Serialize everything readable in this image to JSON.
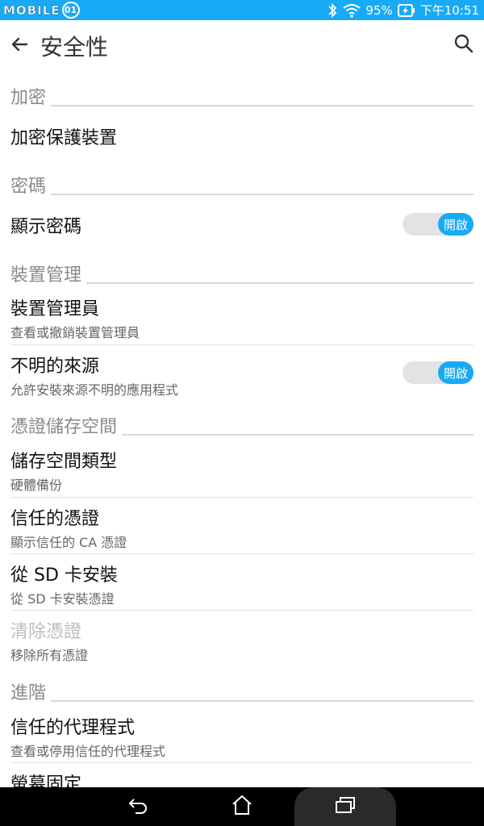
{
  "status_bar": {
    "logo_text": "MOBILE",
    "logo_face": "01",
    "battery": "95%",
    "time": "下午10:51",
    "icons": [
      "bluetooth-icon",
      "wifi-icon",
      "battery-charging-icon"
    ]
  },
  "app_bar": {
    "title": "安全性",
    "back_icon": "arrow-back-icon",
    "search_icon": "search-icon"
  },
  "sections": {
    "encryption": {
      "header": "加密",
      "items": [
        {
          "title": "加密保護裝置"
        }
      ]
    },
    "passwords": {
      "header": "密碼",
      "items": [
        {
          "title": "顯示密碼",
          "toggle_label": "開啟"
        }
      ]
    },
    "device_admin": {
      "header": "裝置管理",
      "items": [
        {
          "title": "裝置管理員",
          "subtitle": "查看或撤銷裝置管理員"
        },
        {
          "title": "不明的來源",
          "subtitle": "允許安裝來源不明的應用程式",
          "toggle_label": "開啟"
        }
      ]
    },
    "credential_storage": {
      "header": "憑證儲存空間",
      "items": [
        {
          "title": "儲存空間類型",
          "subtitle": "硬體備份"
        },
        {
          "title": "信任的憑證",
          "subtitle": "顯示信任的 CA 憑證"
        },
        {
          "title": "從 SD 卡安裝",
          "subtitle": "從 SD 卡安裝憑證"
        },
        {
          "title": "清除憑證",
          "subtitle": "移除所有憑證",
          "disabled": true
        }
      ]
    },
    "advanced": {
      "header": "進階",
      "items": [
        {
          "title": "信任的代理程式",
          "subtitle": "查看或停用信任的代理程式"
        },
        {
          "title": "螢幕固定"
        }
      ]
    }
  },
  "nav_bar": {
    "icons": [
      "nav-back-icon",
      "nav-home-icon",
      "nav-recent-apps-icon"
    ]
  },
  "colors": {
    "accent": "#19aaf5",
    "section_header": "#8a8a8a",
    "divider": "#d9d9d9",
    "disabled": "#bdbdbd"
  }
}
